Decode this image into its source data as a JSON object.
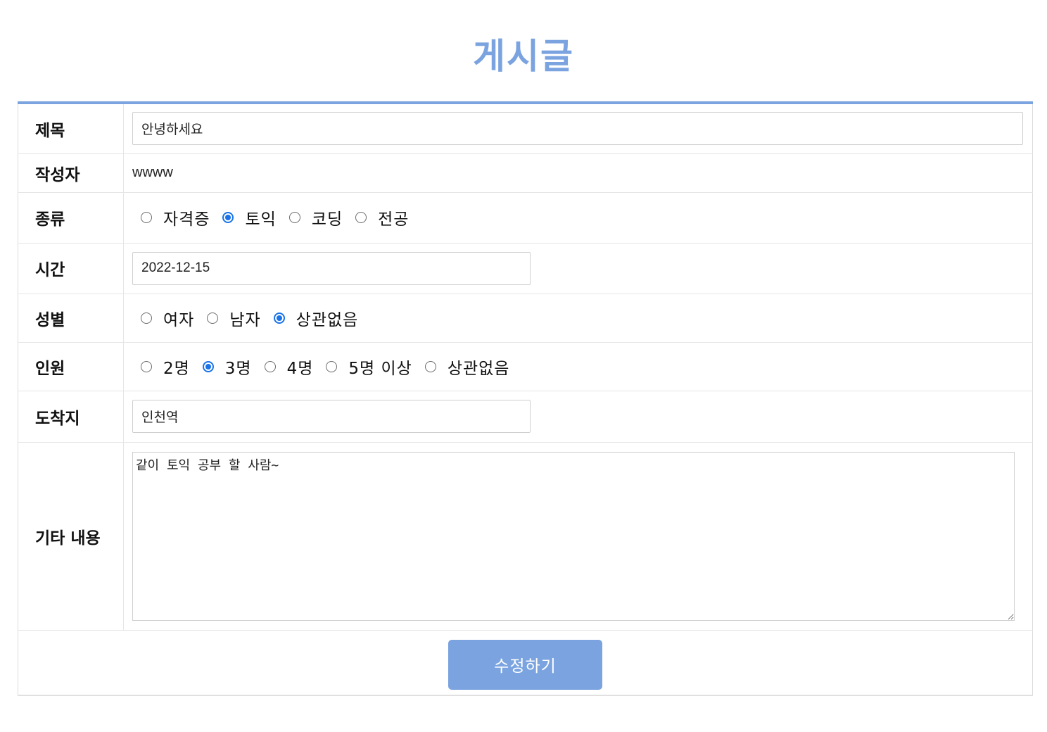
{
  "page": {
    "title": "게시글"
  },
  "form": {
    "title": {
      "label": "제목",
      "value": "안녕하세요"
    },
    "author": {
      "label": "작성자",
      "value": "wwww"
    },
    "category": {
      "label": "종류",
      "options": [
        "자격증",
        "토익",
        "코딩",
        "전공"
      ],
      "selected": "토익"
    },
    "time": {
      "label": "시간",
      "value": "2022-12-15"
    },
    "gender": {
      "label": "성별",
      "options": [
        "여자",
        "남자",
        "상관없음"
      ],
      "selected": "상관없음"
    },
    "headcount": {
      "label": "인원",
      "options": [
        "2명",
        "3명",
        "4명",
        "5명 이상",
        "상관없음"
      ],
      "selected": "3명"
    },
    "destination": {
      "label": "도착지",
      "value": "인천역"
    },
    "memo": {
      "label": "기타 내용",
      "value": "같이 토익 공부 할 사람~"
    },
    "submit_label": "수정하기"
  },
  "colors": {
    "accent": "#7aa3e0",
    "radio_checked": "#1a73e8"
  }
}
